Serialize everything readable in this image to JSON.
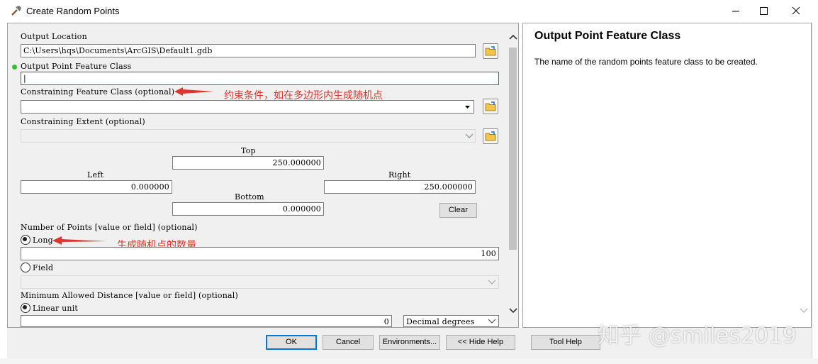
{
  "window": {
    "title": "Create Random Points",
    "minimize_icon": "minimize-icon",
    "maximize_icon": "maximize-icon",
    "close_icon": "close-icon",
    "title_icon": "hammer-icon"
  },
  "form": {
    "output_location": {
      "label": "Output Location",
      "value": "C:\\Users\\hqs\\Documents\\ArcGIS\\Default1.gdb"
    },
    "output_point_fc": {
      "label": "Output Point Feature Class",
      "value": "|"
    },
    "constraining_fc": {
      "label": "Constraining Feature Class (optional)",
      "value": ""
    },
    "constraining_extent": {
      "label": "Constraining Extent (optional)",
      "value": "",
      "top_label": "Top",
      "top_value": "250.000000",
      "left_label": "Left",
      "left_value": "0.000000",
      "right_label": "Right",
      "right_value": "250.000000",
      "bottom_label": "Bottom",
      "bottom_value": "0.000000",
      "clear_label": "Clear"
    },
    "number_of_points": {
      "label": "Number of Points [value or field] (optional)",
      "long_label": "Long",
      "long_value": "100",
      "field_label": "Field",
      "field_value": ""
    },
    "min_distance": {
      "label": "Minimum Allowed Distance [value or field] (optional)",
      "linear_label": "Linear unit",
      "linear_value": "0",
      "unit_value": "Decimal degrees"
    }
  },
  "annotations": {
    "constraining_note": "约束条件，如在多边形内生成随机点",
    "points_note": "生成随机点的数量"
  },
  "help": {
    "title": "Output Point Feature Class",
    "body": "The name of the random points feature class to be created."
  },
  "buttons": {
    "ok": "OK",
    "cancel": "Cancel",
    "environments": "Environments...",
    "hide_help": "<< Hide Help",
    "tool_help": "Tool Help"
  },
  "watermark": "知乎 @smiles2019",
  "colors": {
    "annotation": "#e0352b",
    "accent": "#0078d7",
    "required_dot": "#2ec12e"
  }
}
